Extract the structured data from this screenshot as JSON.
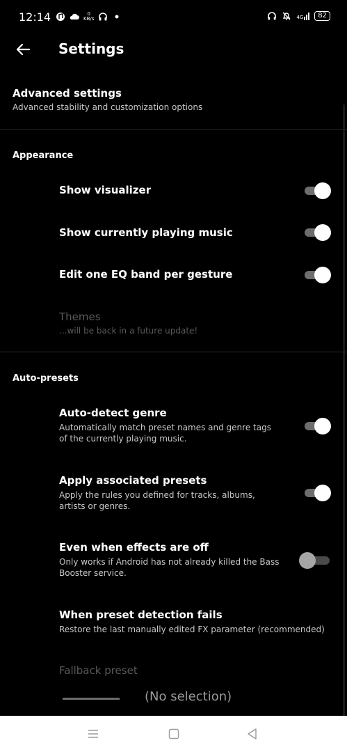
{
  "status_bar": {
    "time": "12:14",
    "speed": "0",
    "speed_unit": "KB/s",
    "network": "4G",
    "battery": "82"
  },
  "header": {
    "title": "Settings"
  },
  "advanced": {
    "title": "Advanced settings",
    "subtitle": "Advanced stability and customization options"
  },
  "appearance": {
    "header": "Appearance",
    "items": [
      {
        "title": "Show visualizer",
        "toggle": true
      },
      {
        "title": "Show currently playing music",
        "toggle": true
      },
      {
        "title": "Edit one EQ band per gesture",
        "toggle": true
      }
    ],
    "themes": {
      "title": "Themes",
      "subtitle": "...will be back in a future update!"
    }
  },
  "autopresets": {
    "header": "Auto-presets",
    "items": [
      {
        "title": "Auto-detect genre",
        "subtitle": "Automatically match preset names and genre tags of the currently playing music.",
        "toggle": true
      },
      {
        "title": "Apply associated presets",
        "subtitle": "Apply the rules you defined for tracks, albums, artists or genres.",
        "toggle": true
      },
      {
        "title": "Even when effects are off",
        "subtitle": "Only works if Android has not already killed the Bass Booster service.",
        "toggle": false
      }
    ],
    "fail": {
      "title": "When preset detection fails",
      "subtitle": "Restore the last manually edited FX parameter (recommended)"
    },
    "fallback": {
      "title": "Fallback preset",
      "value": "(No selection)"
    }
  },
  "colors": {
    "background": "#000000",
    "navbar": "#ffffff",
    "toggle_thumb": "#ffffff"
  }
}
